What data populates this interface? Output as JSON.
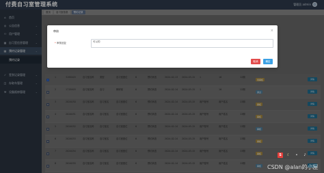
{
  "app": {
    "title": "付费自习室管理系统",
    "user_name": "管理员 admin"
  },
  "sidebar": {
    "items": [
      {
        "label": "首页",
        "icon": "home-icon"
      },
      {
        "label": "公告信息",
        "icon": "bell-icon"
      },
      {
        "label": "用户管理",
        "icon": "users-icon"
      },
      {
        "label": "自习室信息管理",
        "icon": "building-icon"
      },
      {
        "label": "预约记录管理",
        "icon": "calendar-icon"
      },
      {
        "label": "预约记录",
        "icon": "list-icon"
      },
      {
        "label": "签到记录管理",
        "icon": "check-icon"
      },
      {
        "label": "存取车管理",
        "icon": "car-icon"
      },
      {
        "label": "设备报修管理",
        "icon": "wrench-icon"
      }
    ]
  },
  "tabs": [
    {
      "label": "首页"
    },
    {
      "label": "自习室信息"
    },
    {
      "label": "预约记录"
    }
  ],
  "modal": {
    "title": "审核",
    "field_label": "审核回复",
    "field_value": "可以的",
    "cancel": "取消",
    "confirm": "确定",
    "close_glyph": "×"
  },
  "table": {
    "rows": [
      {
        "idx": "1",
        "code": "3195003",
        "name": "自习室名称",
        "type": "类型",
        "seat": "自习室座位",
        "num": "6",
        "state": "预约状态",
        "t1": "2024-02-13",
        "t2": "2024-03-15",
        "user": "1",
        "fee": "16",
        "date": "12期",
        "status": "待审核",
        "status_kind": "warn",
        "btn": "详情",
        "checked": true
      },
      {
        "idx": "2",
        "code": "1715003",
        "name": "自习室名称",
        "type": "自习",
        "seat": "教研室",
        "num": "6",
        "state": "预约状态",
        "t1": "2024-02-14",
        "t2": "2024-03-15",
        "user": "1",
        "fee": "16",
        "date": "12期",
        "status": "通过",
        "status_kind": "ok",
        "btn": "详情",
        "checked": false
      },
      {
        "idx": "3",
        "code": "2024030",
        "name": "自习室名称",
        "type": "自习室名",
        "seat": "自习室座位",
        "num": "6",
        "state": "预约状态",
        "t1": "2024-02-14",
        "t2": "2024-03-15",
        "user": "用户账号",
        "fee": "用户姓名",
        "date": "13期",
        "status": "审核",
        "status_kind": "warn",
        "btn": "详情",
        "checked": false
      },
      {
        "idx": "4",
        "code": "2024031",
        "name": "自习室名称",
        "type": "自习室名",
        "seat": "自习室座位",
        "num": "6",
        "state": "预约状态",
        "t1": "2024-02-14",
        "t2": "2024-03-15",
        "user": "用户账号",
        "fee": "用户姓名",
        "date": "13期",
        "status": "审核",
        "status_kind": "warn",
        "btn": "详情",
        "checked": false
      },
      {
        "idx": "5",
        "code": "2024032",
        "name": "自习室名称",
        "type": "自习室名",
        "seat": "自习室座位",
        "num": "6",
        "state": "预约状态",
        "t1": "2024-02-14",
        "t2": "2024-03-15",
        "user": "用户账号",
        "fee": "用户姓名",
        "date": "13期",
        "status": "审核",
        "status_kind": "ok",
        "btn": "详情",
        "checked": false
      },
      {
        "idx": "6",
        "code": "2024033",
        "name": "自习室名称",
        "type": "自习室名",
        "seat": "自习室座位",
        "num": "6",
        "state": "预约状态",
        "t1": "2024-02-14",
        "t2": "2024-03-15",
        "user": "用户账号",
        "fee": "用户姓名",
        "date": "13期",
        "status": "审核",
        "status_kind": "warn",
        "btn": "详情",
        "checked": false
      },
      {
        "idx": "7",
        "code": "2024034",
        "name": "自习室名称",
        "type": "自习室名",
        "seat": "自习室座位",
        "num": "6",
        "state": "预约状态",
        "t1": "2024-02-14",
        "t2": "2024-03-15",
        "user": "用户账号",
        "fee": "用户姓名",
        "date": "13期",
        "status": "审核",
        "status_kind": "warn",
        "btn": "详情",
        "checked": false
      },
      {
        "idx": "8",
        "code": "2024035",
        "name": "自习室名称",
        "type": "自习室名",
        "seat": "自习室座位",
        "num": "6",
        "state": "预约状态",
        "t1": "2024-02-14",
        "t2": "2024-03-15",
        "user": "用户账号",
        "fee": "用户姓名",
        "date": "13期",
        "status": "审核",
        "status_kind": "ok",
        "btn": "详情",
        "checked": false
      }
    ]
  },
  "watermark": {
    "text": "CSDN @alan的小屋"
  }
}
